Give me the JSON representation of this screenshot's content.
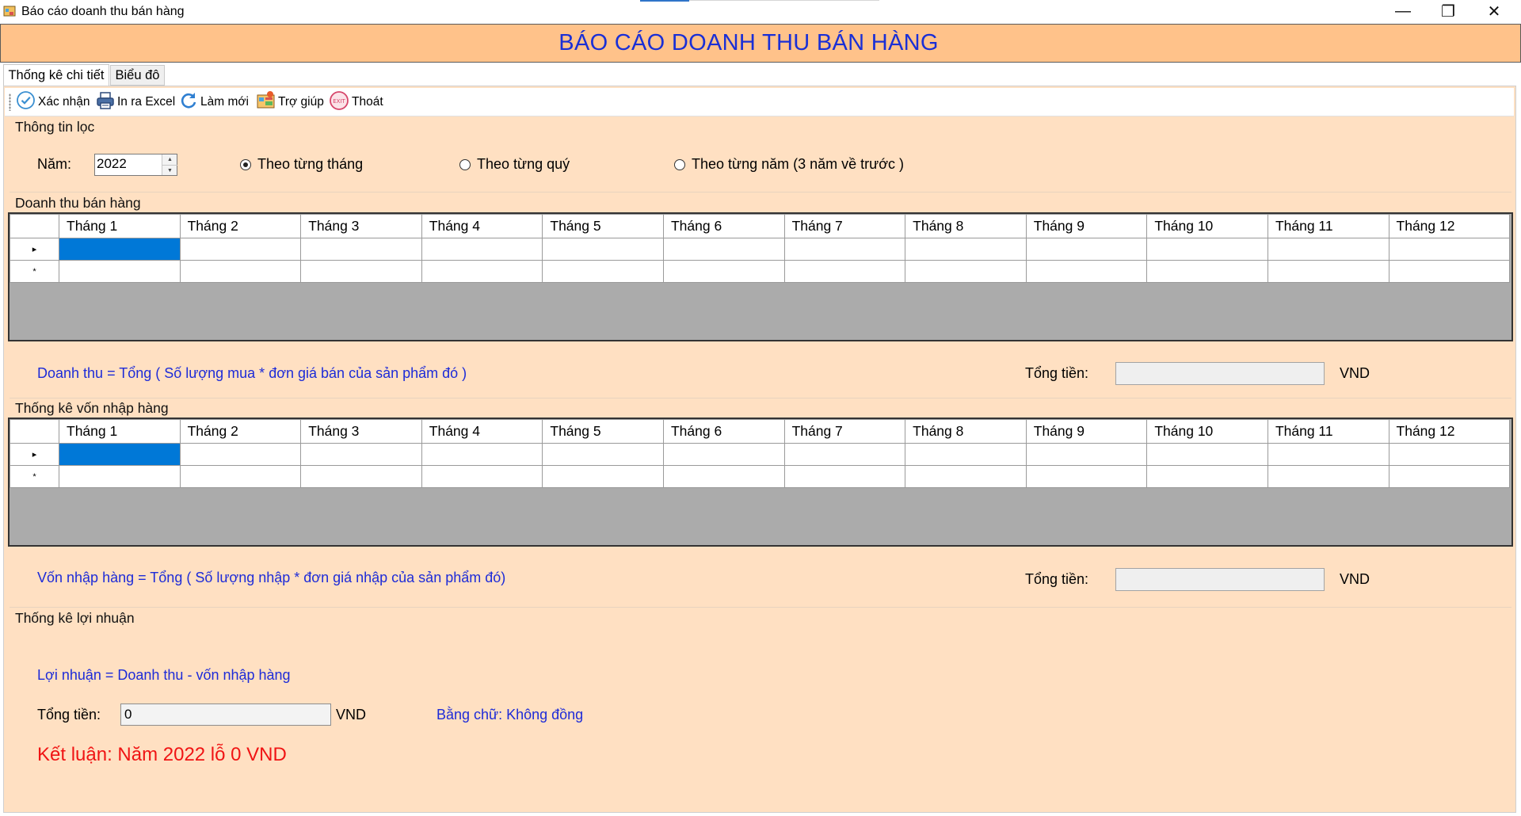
{
  "window": {
    "title": "Báo cáo doanh thu bán hàng",
    "controls": {
      "minimize": "—",
      "maximize": "❐",
      "close": "✕"
    }
  },
  "header": {
    "title": "BÁO CÁO DOANH THU BÁN HÀNG"
  },
  "tabs": [
    {
      "label": "Thống kê chi tiết",
      "selected": true
    },
    {
      "label": "Biểu đô",
      "selected": false
    }
  ],
  "toolbar": {
    "buttons": [
      {
        "label": "Xác nhận",
        "icon": "check-circle-icon"
      },
      {
        "label": "In ra Excel",
        "icon": "printer-icon"
      },
      {
        "label": "Làm mới",
        "icon": "refresh-icon"
      },
      {
        "label": "Trợ giúp",
        "icon": "help-icon"
      },
      {
        "label": "Thoát",
        "icon": "exit-icon"
      }
    ]
  },
  "filter": {
    "group_label": "Thông tin lọc",
    "year_label": "Năm:",
    "year_value": "2022",
    "radios": [
      {
        "label": "Theo từng tháng",
        "checked": true
      },
      {
        "label": "Theo từng quý",
        "checked": false
      },
      {
        "label": "Theo từng năm (3 năm về trước )",
        "checked": false
      }
    ]
  },
  "month_headers": [
    "Tháng 1",
    "Tháng 2",
    "Tháng 3",
    "Tháng 4",
    "Tháng 5",
    "Tháng 6",
    "Tháng 7",
    "Tháng 8",
    "Tháng 9",
    "Tháng 10",
    "Tháng 11",
    "Tháng 12"
  ],
  "revenue": {
    "group_label": "Doanh thu bán hàng",
    "row_markers": [
      "▸",
      "*"
    ],
    "formula": "Doanh thu = Tổng ( Số lượng mua * đơn giá bán của sản phẩm đó )",
    "total_label": "Tổng tiền:",
    "total_value": "",
    "unit": "VND"
  },
  "cost": {
    "group_label": "Thống kê vốn nhập hàng",
    "row_markers": [
      "▸",
      "*"
    ],
    "formula": "Vốn nhập hàng = Tổng ( Số lượng nhập * đơn giá nhập của sản phẩm đó)",
    "total_label": "Tổng tiền:",
    "total_value": "",
    "unit": "VND"
  },
  "profit": {
    "group_label": "Thống kê lợi nhuận",
    "formula": "Lợi nhuận = Doanh thu - vốn nhập hàng",
    "total_label": "Tổng tiền:",
    "total_value": "0",
    "unit": "VND",
    "in_words": "Bằng chữ: Không đồng",
    "conclusion": "Kết luận: Năm 2022 lỗ  0 VND"
  },
  "colors": {
    "header_bg": "#ffc28a",
    "panel_bg": "#ffe0c2",
    "title_text": "#1a2fd6",
    "formula_text": "#1d2bd8",
    "conclusion_text": "#f01414",
    "selected_cell": "#0078d7"
  }
}
